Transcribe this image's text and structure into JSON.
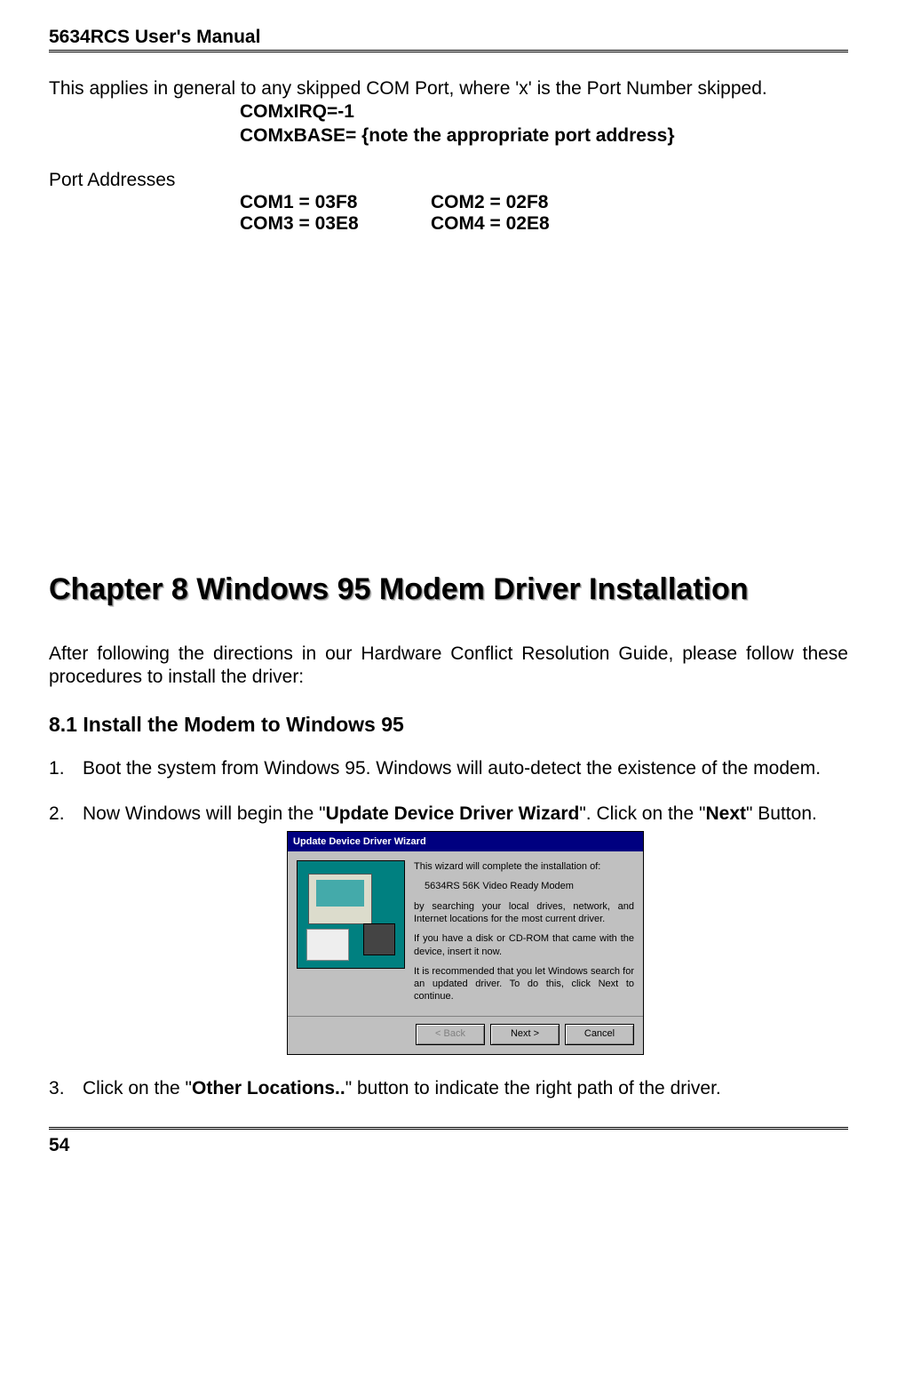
{
  "header": {
    "title": "5634RCS User's Manual"
  },
  "intro": {
    "line1": "This applies in general to any skipped COM Port, where 'x' is the Port Number skipped.",
    "com_irq": "COMxIRQ=-1",
    "com_base": "COMxBASE= {note the appropriate port address}"
  },
  "ports": {
    "label": "Port Addresses",
    "rows": [
      {
        "a": "COM1 = 03F8",
        "b": "COM2 = 02F8"
      },
      {
        "a": "COM3 = 03E8",
        "b": "COM4 = 02E8"
      }
    ]
  },
  "chapter": {
    "title": "Chapter 8 Windows 95 Modem Driver Installation",
    "intro": "After following the directions in our Hardware Conflict Resolution Guide, please follow these procedures to install the driver:"
  },
  "section": {
    "title": "8.1 Install the Modem to Windows 95"
  },
  "steps": {
    "s1": "Boot the system from Windows 95. Windows will auto-detect the existence of the modem.",
    "s2_a": "Now Windows will begin the \"",
    "s2_b": "Update Device Driver Wizard",
    "s2_c": "\". Click on the \"",
    "s2_d": "Next",
    "s2_e": "\" Button.",
    "s3_a": "Click on the \"",
    "s3_b": "Other Locations..",
    "s3_c": "\" button to indicate the right path of the driver."
  },
  "wizard": {
    "title": "Update Device Driver Wizard",
    "p1": "This wizard will complete the installation of:",
    "device": "5634RS 56K Video Ready Modem",
    "p2": "by searching your local drives, network, and Internet locations for the most current driver.",
    "p3": "If you have a disk or CD-ROM that came with the device, insert it now.",
    "p4": "It is recommended that you let Windows search for an updated driver. To do this, click Next to continue.",
    "btn_back": "< Back",
    "btn_next": "Next >",
    "btn_cancel": "Cancel"
  },
  "footer": {
    "page": "54"
  }
}
